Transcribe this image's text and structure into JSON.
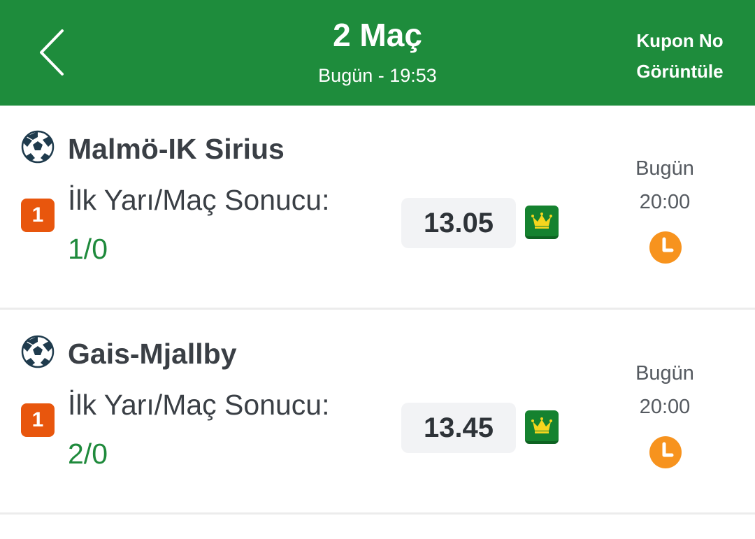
{
  "header": {
    "title": "2 Maç",
    "subtitle": "Bugün - 19:53",
    "coupon_link": "Kupon No Görüntüle"
  },
  "matches": [
    {
      "teams": "Malmö-IK Sirius",
      "mbs": "1",
      "market": "İlk Yarı/Maç Sonucu:",
      "selection": "1/0",
      "odds": "13.05",
      "date": "Bugün",
      "time": "20:00"
    },
    {
      "teams": "Gais-Mjallby",
      "mbs": "1",
      "market": "İlk Yarı/Maç Sonucu:",
      "selection": "2/0",
      "odds": "13.45",
      "date": "Bugün",
      "time": "20:00"
    }
  ],
  "colors": {
    "header_bg": "#1e8c3c",
    "selection_green": "#1f8a3c",
    "mbs_orange": "#e8560d",
    "clock_orange": "#f7931e",
    "crown_bg": "#15822f",
    "crown_gold": "#f5d51e"
  },
  "icons": {
    "back": "chevron-left-icon",
    "sport": "soccer-ball-icon",
    "crown": "crown-icon",
    "clock": "clock-icon"
  }
}
